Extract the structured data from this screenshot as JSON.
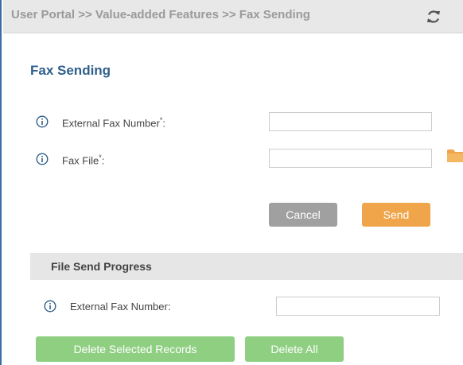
{
  "header": {
    "breadcrumb": "User Portal >> Value-added Features >> Fax Sending",
    "refresh_icon": "refresh-icon"
  },
  "main": {
    "title": "Fax Sending",
    "form": {
      "external_fax_number": {
        "label": "External Fax Number",
        "required_mark": "*",
        "suffix": ":",
        "value": "",
        "icon": "info-icon"
      },
      "fax_file": {
        "label": "Fax File",
        "required_mark": "*",
        "suffix": ":",
        "value": "",
        "icon": "info-icon",
        "browse_icon": "folder-icon"
      },
      "cancel_label": "Cancel",
      "send_label": "Send"
    },
    "progress": {
      "title": "File Send Progress",
      "filter": {
        "label": "External Fax Number:",
        "value": "",
        "icon": "info-icon"
      },
      "delete_selected_label": "Delete Selected Records",
      "delete_all_label": "Delete All"
    }
  },
  "colors": {
    "accent_title": "#2f5f8a",
    "send_button": "#f0a54a",
    "cancel_button": "#a0a0a0",
    "green_button": "#8fcf82",
    "info_icon": "#2f5f8a",
    "folder_icon": "#f0a54a"
  }
}
